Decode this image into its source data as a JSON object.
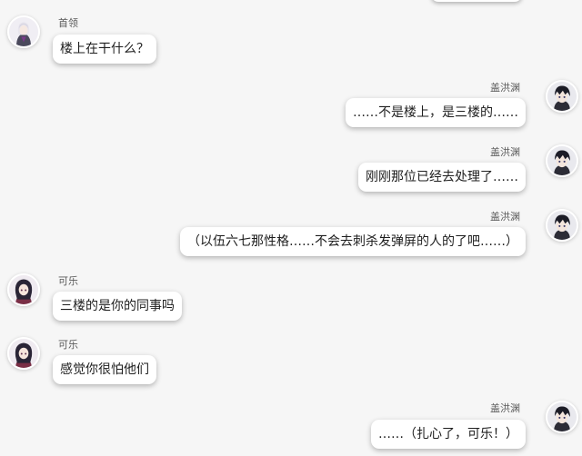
{
  "chat": {
    "messages": [
      {
        "side": "left",
        "avatar": "leader-avatar",
        "name": "首领",
        "text": "楼上在干什么？"
      },
      {
        "side": "right",
        "avatar": "gai-avatar",
        "name": "盖洪渊",
        "text": "……不是楼上，是三楼的……"
      },
      {
        "side": "right",
        "avatar": "gai-avatar",
        "name": "盖洪渊",
        "text": "刚刚那位已经去处理了……"
      },
      {
        "side": "right",
        "avatar": "gai-avatar",
        "name": "盖洪渊",
        "text": "（以伍六七那性格……不会去刺杀发弹屏的人的了吧……）"
      },
      {
        "side": "left",
        "avatar": "kele-avatar",
        "name": "可乐",
        "text": "三楼的是你的同事吗"
      },
      {
        "side": "left",
        "avatar": "kele-avatar",
        "name": "可乐",
        "text": "感觉你很怕他们"
      },
      {
        "side": "right",
        "avatar": "gai-avatar",
        "name": "盖洪渊",
        "text": "……（扎心了，可乐！）"
      }
    ]
  }
}
